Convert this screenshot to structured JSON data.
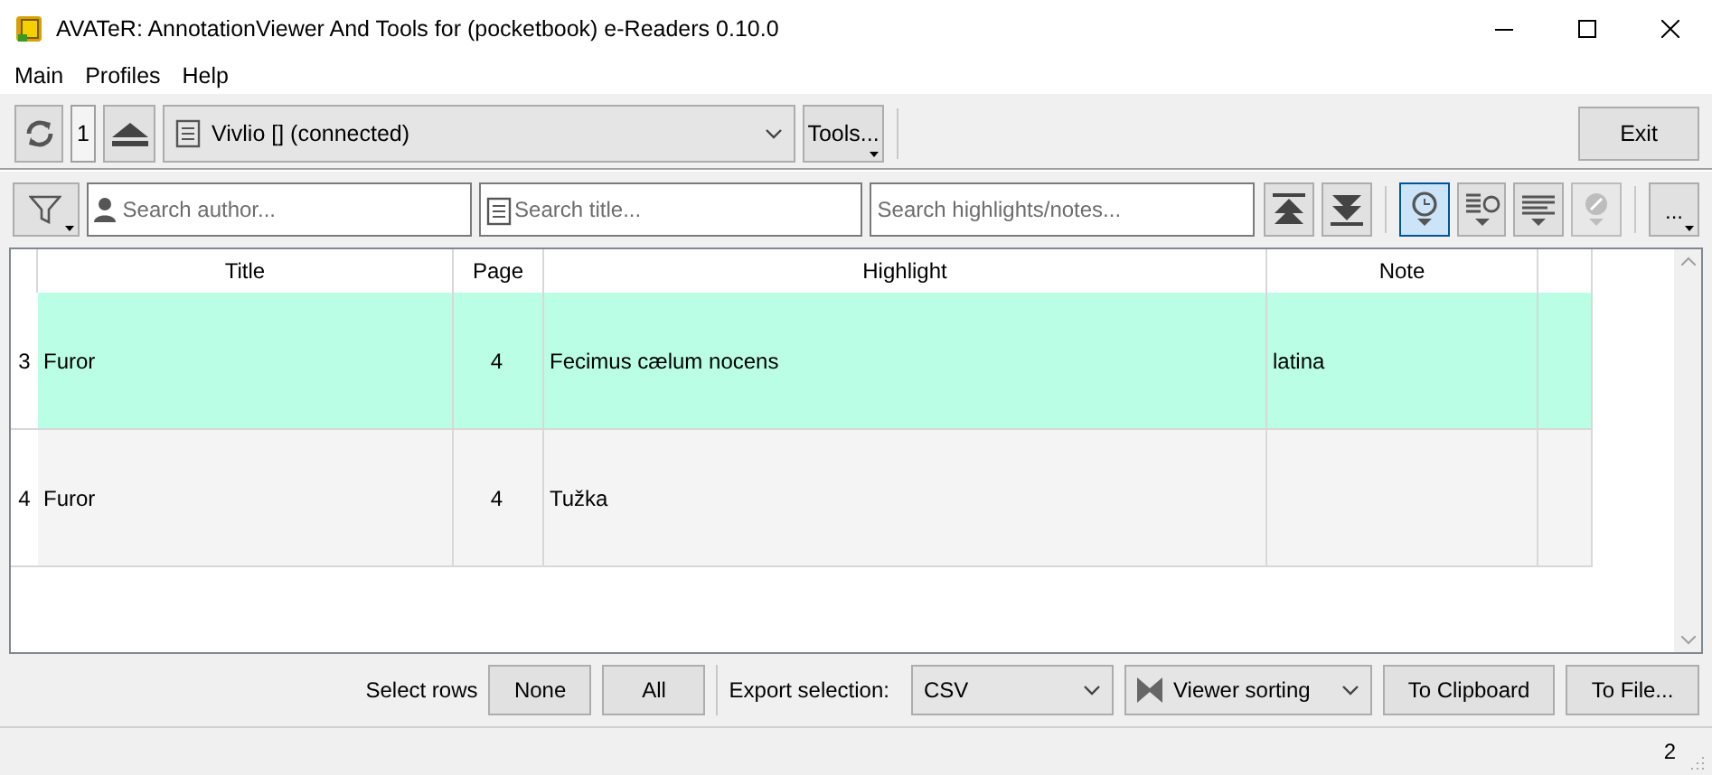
{
  "window": {
    "title": "AVATeR: AnnotationViewer And Tools for (pocketbook) e-Readers 0.10.0"
  },
  "menu": [
    "Main",
    "Profiles",
    "Help"
  ],
  "device_bar": {
    "count": "1",
    "device": "Vivlio [] (connected)",
    "tools_button": "Tools...",
    "exit_button": "Exit"
  },
  "filter_bar": {
    "author_search": {
      "placeholder": "Search author..."
    },
    "title_search": {
      "placeholder": "Search title..."
    },
    "text_search": {
      "placeholder": "Search highlights/notes..."
    },
    "view_buttons": [
      {
        "kind": "clock",
        "pressed": true,
        "disabled": false
      },
      {
        "kind": "list-clock",
        "pressed": false,
        "disabled": false
      },
      {
        "kind": "list",
        "pressed": false,
        "disabled": false
      },
      {
        "kind": "pin",
        "pressed": false,
        "disabled": true
      }
    ],
    "more_button": "..."
  },
  "table": {
    "columns": [
      "Title",
      "Page",
      "Highlight",
      "Note"
    ],
    "rows": [
      {
        "number": "3",
        "selected": true,
        "title": "Furor",
        "page": "4",
        "highlight": "Fecimus cælum nocens",
        "note": "latina"
      },
      {
        "number": "4",
        "selected": false,
        "title": "Furor",
        "page": "4",
        "highlight": "Tužka"
      }
    ]
  },
  "export_bar": {
    "select_label": "Select rows",
    "none_button": "None",
    "all_button": "All",
    "export_label": "Export selection:",
    "format": "CSV",
    "sorting": "Viewer sorting",
    "clipboard_button": "To Clipboard",
    "file_button": "To File..."
  },
  "status_bar": {
    "count": "2"
  }
}
